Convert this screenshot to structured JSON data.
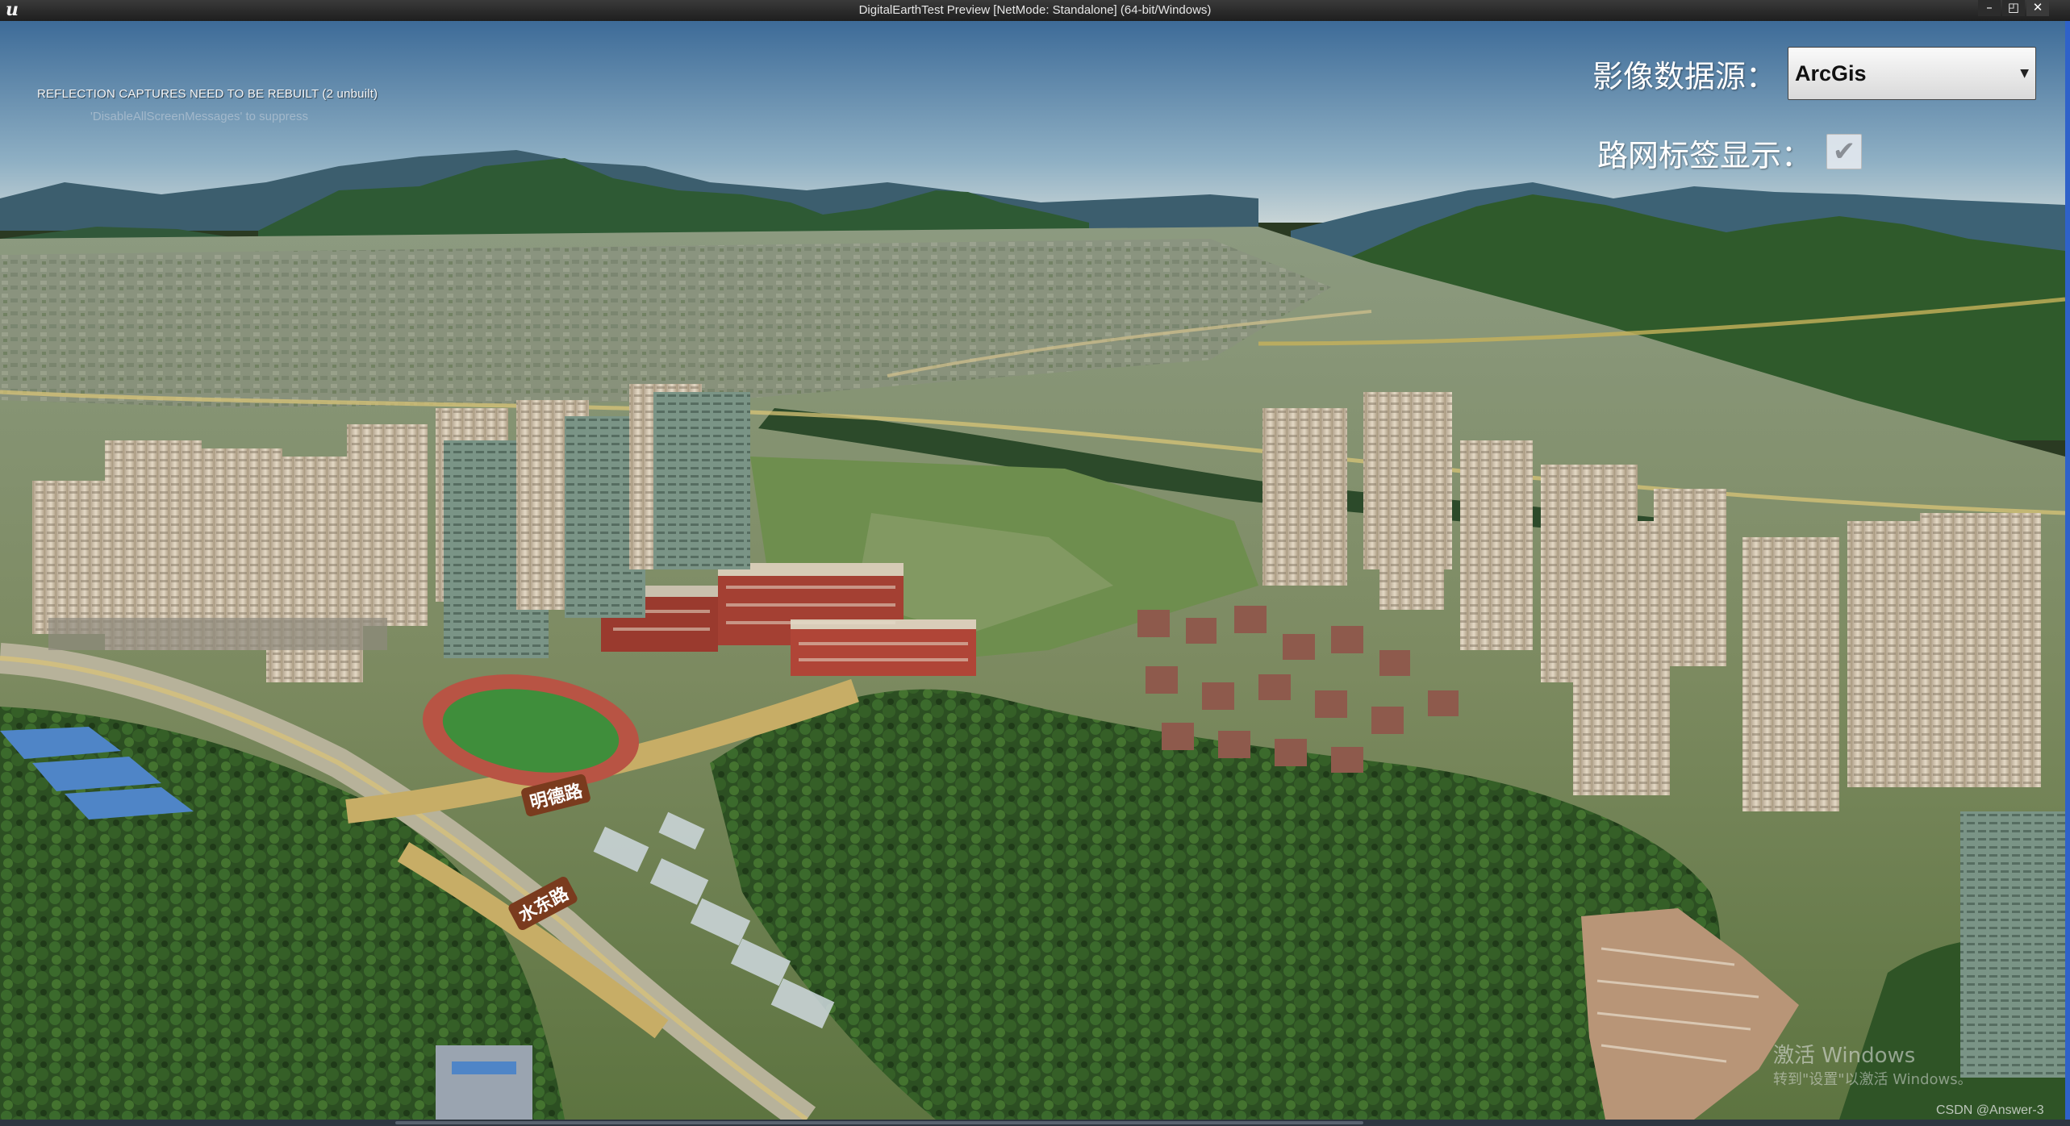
{
  "window": {
    "logo": "u",
    "title": "DigitalEarthTest Preview [NetMode: Standalone]  (64-bit/Windows)",
    "minimize_glyph": "–",
    "restore_glyph": "◰",
    "close_glyph": "✕"
  },
  "debug": {
    "line1": "REFLECTION CAPTURES NEED TO BE REBUILT (2 unbuilt)",
    "line2": "'DisableAllScreenMessages' to suppress"
  },
  "controls": {
    "imagery_source_label": "影像数据源：",
    "imagery_source_value": "ArcGis",
    "road_label_toggle_label": "路网标签显示：",
    "road_label_toggle_checked": true
  },
  "map_labels": {
    "road_1": "明德路",
    "road_2": "水东路"
  },
  "overlay": {
    "watermark_line1": "激活 Windows",
    "watermark_line2": "转到\"设置\"以激活 Windows。",
    "credit": "CSDN @Answer-3"
  },
  "colors": {
    "sky_top": "#3f6d9a",
    "sky_horizon": "#b9cbd3",
    "mountain": "#2f5a36",
    "forest": "#2f5524",
    "tower": "#d9cdb9",
    "track": "#b84a36",
    "field": "#3f8a3a",
    "road": "#d6b96a"
  }
}
